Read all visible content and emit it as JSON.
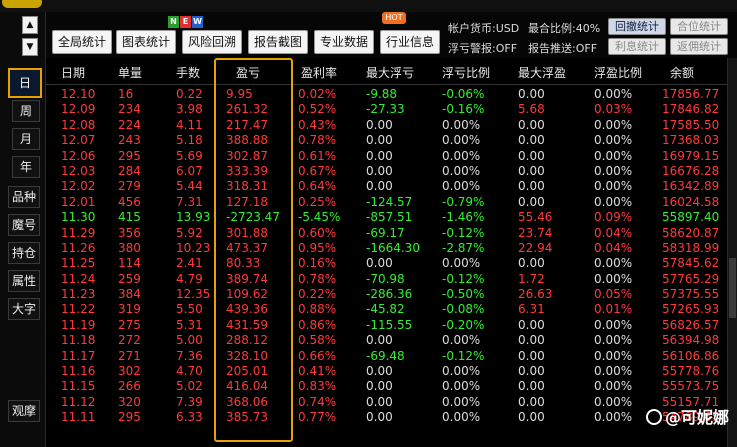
{
  "colors": {
    "up": "#ff3a3a",
    "down": "#33ee33",
    "neutral": "#dddddd",
    "highlight": "#e8a100"
  },
  "sidebar": {
    "items": [
      "日",
      "周",
      "月",
      "年",
      "品种",
      "魔号",
      "持仓",
      "属性",
      "大字",
      "观摩"
    ],
    "selected": "日"
  },
  "toolbar": {
    "buttons": [
      "全局统计",
      "图表统计",
      "风险回溯",
      "报告截图",
      "专业数据",
      "行业信息"
    ],
    "new_badge": [
      "N",
      "E",
      "W"
    ],
    "hot_badge": "HOT",
    "account_currency": "帐户货币:USD",
    "max_ratio": "最合比例:40%",
    "float_loss_alert": "浮亏警报:OFF",
    "report_push": "报告推送:OFF",
    "right_buttons": [
      "回撤统计",
      "合位统计",
      "利息统计",
      "返佣统计"
    ]
  },
  "table": {
    "headers": [
      "日期",
      "单量",
      "手数",
      "盈亏",
      "盈利率",
      "最大浮亏",
      "浮亏比例",
      "最大浮盈",
      "浮盈比例",
      "余额"
    ],
    "rows": [
      [
        "12.10",
        "16",
        "0.22",
        "9.95",
        "0.02%",
        "-9.88",
        "-0.06%",
        "0.00",
        "0.00%",
        "17856.77"
      ],
      [
        "12.09",
        "234",
        "3.98",
        "261.32",
        "0.52%",
        "-27.33",
        "-0.16%",
        "5.68",
        "0.03%",
        "17846.82"
      ],
      [
        "12.08",
        "224",
        "4.11",
        "217.47",
        "0.43%",
        "0.00",
        "0.00%",
        "0.00",
        "0.00%",
        "17585.50"
      ],
      [
        "12.07",
        "243",
        "5.18",
        "388.88",
        "0.78%",
        "0.00",
        "0.00%",
        "0.00",
        "0.00%",
        "17368.03"
      ],
      [
        "12.06",
        "295",
        "5.69",
        "302.87",
        "0.61%",
        "0.00",
        "0.00%",
        "0.00",
        "0.00%",
        "16979.15"
      ],
      [
        "12.03",
        "284",
        "6.07",
        "333.39",
        "0.67%",
        "0.00",
        "0.00%",
        "0.00",
        "0.00%",
        "16676.28"
      ],
      [
        "12.02",
        "279",
        "5.44",
        "318.31",
        "0.64%",
        "0.00",
        "0.00%",
        "0.00",
        "0.00%",
        "16342.89"
      ],
      [
        "12.01",
        "456",
        "7.31",
        "127.18",
        "0.25%",
        "-124.57",
        "-0.79%",
        "0.00",
        "0.00%",
        "16024.58"
      ],
      [
        "11.30",
        "415",
        "13.93",
        "-2723.47",
        "-5.45%",
        "-857.51",
        "-1.46%",
        "55.46",
        "0.09%",
        "55897.40"
      ],
      [
        "11.29",
        "356",
        "5.92",
        "301.88",
        "0.60%",
        "-69.17",
        "-0.12%",
        "23.74",
        "0.04%",
        "58620.87"
      ],
      [
        "11.26",
        "380",
        "10.23",
        "473.37",
        "0.95%",
        "-1664.30",
        "-2.87%",
        "22.94",
        "0.04%",
        "58318.99"
      ],
      [
        "11.25",
        "114",
        "2.41",
        "80.33",
        "0.16%",
        "0.00",
        "0.00%",
        "0.00",
        "0.00%",
        "57845.62"
      ],
      [
        "11.24",
        "259",
        "4.79",
        "389.74",
        "0.78%",
        "-70.98",
        "-0.12%",
        "1.72",
        "0.00%",
        "57765.29"
      ],
      [
        "11.23",
        "384",
        "12.35",
        "109.62",
        "0.22%",
        "-286.36",
        "-0.50%",
        "26.63",
        "0.05%",
        "57375.55"
      ],
      [
        "11.22",
        "319",
        "5.50",
        "439.36",
        "0.88%",
        "-45.82",
        "-0.08%",
        "6.31",
        "0.01%",
        "57265.93"
      ],
      [
        "11.19",
        "275",
        "5.31",
        "431.59",
        "0.86%",
        "-115.55",
        "-0.20%",
        "0.00",
        "0.00%",
        "56826.57"
      ],
      [
        "11.18",
        "272",
        "5.00",
        "288.12",
        "0.58%",
        "0.00",
        "0.00%",
        "0.00",
        "0.00%",
        "56394.98"
      ],
      [
        "11.17",
        "271",
        "7.36",
        "328.10",
        "0.66%",
        "-69.48",
        "-0.12%",
        "0.00",
        "0.00%",
        "56106.86"
      ],
      [
        "11.16",
        "302",
        "4.70",
        "205.01",
        "0.41%",
        "0.00",
        "0.00%",
        "0.00",
        "0.00%",
        "55778.76"
      ],
      [
        "11.15",
        "266",
        "5.02",
        "416.04",
        "0.83%",
        "0.00",
        "0.00%",
        "0.00",
        "0.00%",
        "55573.75"
      ],
      [
        "11.12",
        "320",
        "7.39",
        "368.06",
        "0.74%",
        "0.00",
        "0.00%",
        "0.00",
        "0.00%",
        "55157.71"
      ],
      [
        "11.11",
        "295",
        "6.33",
        "385.73",
        "0.77%",
        "0.00",
        "0.00%",
        "0.00",
        "0.00%",
        "54789.65"
      ]
    ]
  },
  "watermark": "@可妮娜"
}
